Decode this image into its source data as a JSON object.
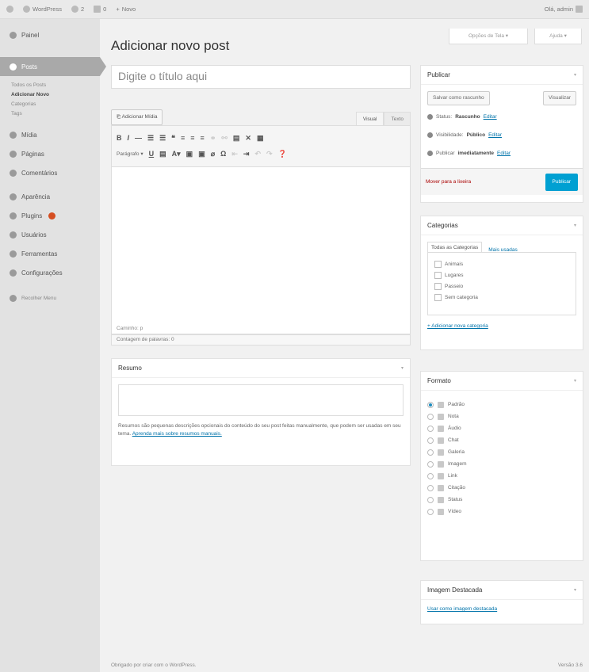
{
  "adminbar": {
    "site": "WordPress",
    "comments": "2",
    "new_count": "0",
    "new": "Novo",
    "greeting": "Olá, admin"
  },
  "sidebar": {
    "items": [
      {
        "label": "Painel",
        "icon": "dashboard-icon"
      },
      {
        "label": "Posts",
        "icon": "pin-icon"
      },
      {
        "label": "Mídia",
        "icon": "media-icon"
      },
      {
        "label": "Páginas",
        "icon": "page-icon"
      },
      {
        "label": "Comentários",
        "icon": "comment-icon"
      },
      {
        "label": "Aparência",
        "icon": "brush-icon"
      },
      {
        "label": "Plugins",
        "icon": "plugin-icon"
      },
      {
        "label": "Usuários",
        "icon": "users-icon"
      },
      {
        "label": "Ferramentas",
        "icon": "wrench-icon"
      },
      {
        "label": "Configurações",
        "icon": "settings-icon"
      },
      {
        "label": "Recolher Menu",
        "icon": "collapse-icon"
      }
    ],
    "submenu": [
      "Todos os Posts",
      "Adicionar Novo",
      "Categorias",
      "Tags"
    ]
  },
  "screen_options": "Opções de Tela ▾",
  "help": "Ajuda ▾",
  "page_title": "Adicionar novo post",
  "title_placeholder": "Digite o título aqui",
  "editor": {
    "add_media": "Adicionar Mídia",
    "visual_tab": "Visual",
    "text_tab": "Texto",
    "format": "Parágrafo",
    "path": "Caminho: p",
    "word_count": "Contagem de palavras: 0"
  },
  "excerpt": {
    "title": "Resumo",
    "desc": "Resumos são pequenas descrições opcionais do conteúdo do seu post feitas manualmente, que podem ser usadas em seu tema.",
    "link": "Aprenda mais sobre resumos manuais."
  },
  "publish": {
    "title": "Publicar",
    "save_draft": "Salvar como rascunho",
    "preview": "Visualizar",
    "status_label": "Status:",
    "status_value": "Rascunho",
    "visibility_label": "Visibilidade:",
    "visibility_value": "Público",
    "schedule_label": "Publicar",
    "schedule_value": "imediatamente",
    "edit": "Editar",
    "trash": "Mover para a lixeira",
    "publish_btn": "Publicar"
  },
  "categories": {
    "title": "Categorias",
    "tab_all": "Todas as Categorias",
    "tab_popular": "Mais usadas",
    "items": [
      "Animais",
      "Lugares",
      "Passeio",
      "Sem categoria"
    ],
    "add_new": "+ Adicionar nova categoria"
  },
  "format_box": {
    "title": "Formato",
    "options": [
      "Padrão",
      "Nota",
      "Áudio",
      "Chat",
      "Galeria",
      "Imagem",
      "Link",
      "Citação",
      "Status",
      "Vídeo"
    ],
    "selected": 0
  },
  "featured": {
    "title": "Imagem Destacada",
    "link": "Usar como imagem destacada"
  },
  "footer": {
    "left": "Obrigado por criar com o WordPress.",
    "right": "Versão 3.6"
  }
}
